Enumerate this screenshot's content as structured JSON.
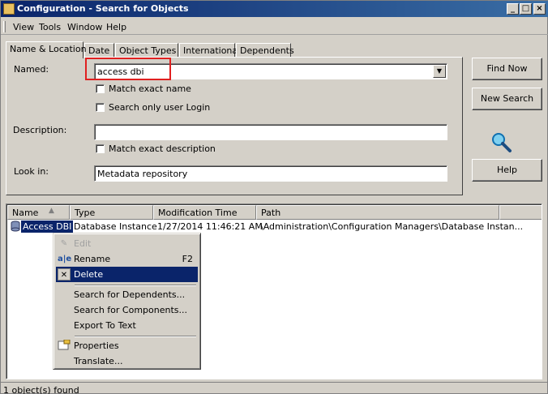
{
  "window": {
    "title": "Configuration - Search for Objects"
  },
  "menu": [
    "View",
    "Tools",
    "Window",
    "Help"
  ],
  "tabs": [
    "Name & Location",
    "Date",
    "Object Types",
    "International",
    "Dependents"
  ],
  "form": {
    "named_label": "Named:",
    "named_value": "access dbi",
    "match_exact_name": "Match exact name",
    "search_user_login": "Search only user Login",
    "description_label": "Description:",
    "description_value": "",
    "match_exact_description": "Match exact description",
    "look_in_label": "Look in:",
    "look_in_value": "Metadata repository"
  },
  "buttons": {
    "find_now": "Find Now",
    "new_search": "New Search",
    "help": "Help"
  },
  "results": {
    "columns": [
      "Name",
      "Type",
      "Modification Time",
      "Path"
    ],
    "rows": [
      {
        "name": "Access DBI",
        "type": "Database Instance",
        "modified": "1/27/2014 11:46:21 AM",
        "path": "\\Administration\\Configuration Managers\\Database Instan..."
      }
    ]
  },
  "context_menu": {
    "edit": "Edit",
    "rename": "Rename",
    "rename_shortcut": "F2",
    "delete": "Delete",
    "search_dependents": "Search for Dependents...",
    "search_components": "Search for Components...",
    "export_text": "Export To Text",
    "properties": "Properties",
    "translate": "Translate..."
  },
  "status": "1 object(s) found",
  "colors": {
    "titlebar": "#0a246a",
    "highlight": "#0a246a",
    "callout": "#e02020",
    "face": "#d4d0c8"
  }
}
